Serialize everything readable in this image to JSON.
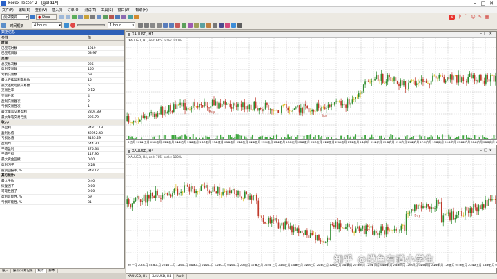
{
  "window": {
    "title": "Forex Tester 2 - [gold1*]",
    "controls": [
      "–",
      "□",
      "✕"
    ]
  },
  "menu": [
    "文件(F)",
    "编辑(E)",
    "查看(V)",
    "插入(I)",
    "订单(O)",
    "测试(T)",
    "工具(S)",
    "窗口(W)",
    "帮助(H)"
  ],
  "toolbar": {
    "mode_value": "测试模式",
    "stop_test": "Stop Test",
    "timeframe_value": "4 hours",
    "timeframe_label": "- 时间框架",
    "timeframe2_value": "1 hour"
  },
  "panel": {
    "title": "数据信息",
    "col_param": "参数",
    "col_value": "值",
    "rows": [
      {
        "k": "时间",
        "v": "",
        "sec": true
      },
      {
        "k": "已完成时数",
        "v": "1919"
      },
      {
        "k": "已完成日数",
        "v": "63.97"
      },
      {
        "k": "交易:",
        "v": "",
        "sec": true
      },
      {
        "k": "总交易次数",
        "v": "225"
      },
      {
        "k": "盈利交易数",
        "v": "156"
      },
      {
        "k": "亏损交易数",
        "v": "69"
      },
      {
        "k": "最大连续盈利交易数",
        "v": "15"
      },
      {
        "k": "最大连续亏损交易数",
        "v": "5"
      },
      {
        "k": "交易胜率",
        "v": "0.12"
      },
      {
        "k": "交易胜次",
        "v": "4"
      },
      {
        "k": "盈利交易胜次",
        "v": "2"
      },
      {
        "k": "亏损交易胜次",
        "v": "1"
      },
      {
        "k": "最大单笔交易盈利",
        "v": "2304.89"
      },
      {
        "k": "最大单笔交易亏损",
        "v": "296.79"
      },
      {
        "k": "收入:",
        "v": "",
        "sec": true
      },
      {
        "k": "净盈利",
        "v": "34817.19"
      },
      {
        "k": "盈利总值",
        "v": "42952.48"
      },
      {
        "k": "亏损总值",
        "v": "8135.29"
      },
      {
        "k": "盈利均",
        "v": "544.30"
      },
      {
        "k": "平均盈利",
        "v": "275.34"
      },
      {
        "k": "平均亏损",
        "v": "117.90"
      },
      {
        "k": "最大资金回撤",
        "v": "0.00"
      },
      {
        "k": "盈利因子",
        "v": "5.28"
      },
      {
        "k": "投资回报率, %",
        "v": "348.17"
      },
      {
        "k": "其它统计:",
        "v": "",
        "sec": true
      },
      {
        "k": "最大手数",
        "v": "0.40"
      },
      {
        "k": "恢复因子",
        "v": "0.00"
      },
      {
        "k": "可靠性因子",
        "v": "0.00"
      },
      {
        "k": "盈利可能性, %",
        "v": "69"
      },
      {
        "k": "亏损可能性, %",
        "v": "31"
      }
    ],
    "tabs": [
      "账户",
      "报价/交易记录",
      "统计",
      "脚本"
    ]
  },
  "chart_top": {
    "tab": "XAUUSD, H1",
    "subtitle": "XAUUSD, H1, cell: 665, scale: 100%",
    "marker_labels": [
      "Buy",
      "Buy"
    ],
    "time_labels": [
      "8 五月 2016",
      "11 五月 09:00",
      "12 五月 05:00",
      "13 五月 01:00",
      "13 五月 21:00",
      "16 五月 17:00",
      "17 五月 13:00",
      "18 五月 09:00",
      "19 五月 05:00",
      "20 五月 01:00",
      "20 五月 21:00",
      "23 五月 17:00",
      "24 五月 13:00",
      "25 五月 09:00",
      "26 五月 05:00",
      "27 五月 01:00",
      "27 五月 21:00",
      "30 五月 17:00",
      "31 五月 13:00",
      "1 六月 09:00",
      "2 六月 05:00",
      "3 六月 01:00",
      "3 六月 21:00",
      "6 六月 17:00",
      "7 六月 13:00",
      "8 六月 09:00",
      "9 六月 05:00",
      "10 六月 01:00",
      "10 六月 21:00",
      "13 六月 17:00"
    ]
  },
  "chart_bottom": {
    "tab": "XAUUSD, H4",
    "subtitle": "XAUUSD, H4, cell: 705, scale: 100%",
    "marker_labels": [
      "Buy",
      "Buy",
      "Buy"
    ],
    "time_labels": [
      "30 一月 2016",
      "3 二月 04:00",
      "5 二月 20:00",
      "10 二月 12:00",
      "15 二月 04:00",
      "17 二月 20:00",
      "22 二月 12:00",
      "25 二月 04:00",
      "29 二月 20:00",
      "3 三月 12:00",
      "8 三月 04:00",
      "10 三月 20:00",
      "15 三月 12:00",
      "18 三月 04:00",
      "22 三月 20:00",
      "25 三月 12:00",
      "30 三月 04:00",
      "1 四月 20:00",
      "6 四月 12:00",
      "11 四月 04:00",
      "13 四月 20:00",
      "18 四月 12:00",
      "21 四月 04:00",
      "25 四月 20:00",
      "28 四月 12:00",
      "3 五月 04:00",
      "5 五月 20:00",
      "10 五月 12:00",
      "13 五月 04:00"
    ]
  },
  "bottom_tabs": [
    "XAUUSD, H1",
    "XAUUSD, H4",
    "Profit"
  ],
  "bottom_active": "XAUUSD, H4",
  "watermark": "知乎 @摸鱼有道小学生",
  "colors": {
    "bull": "#2e8b2e",
    "bear": "#c0392b",
    "volume": "#3fa83f",
    "doji": "#e0c020",
    "title_blue": "#2d5fb7"
  }
}
